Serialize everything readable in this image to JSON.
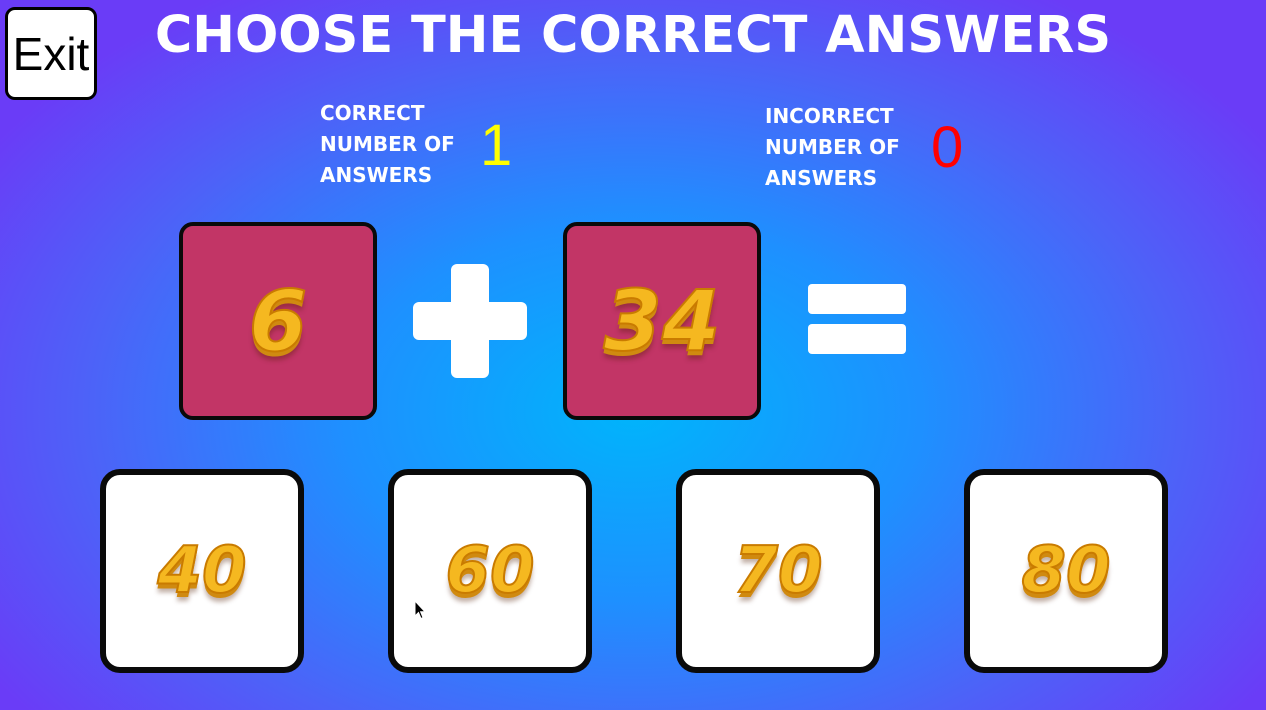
{
  "exit_label": "Exit",
  "title": "CHOOSE THE CORRECT ANSWERS",
  "correct": {
    "label_lines": [
      "CORRECT",
      "NUMBER OF",
      "ANSWERS"
    ],
    "value": "1",
    "color": "#ffff00"
  },
  "incorrect": {
    "label_lines": [
      "INCORRECT",
      "NUMBER OF",
      "ANSWERS"
    ],
    "value": "0",
    "color": "#ff0000"
  },
  "equation": {
    "operand1": "6",
    "operator": "plus-icon",
    "operand2": "34",
    "result": "equals-icon"
  },
  "answers": [
    "40",
    "60",
    "70",
    "80"
  ],
  "colors": {
    "operand_card": "#c23566",
    "number_fill": "#f5b820",
    "background_center": "#00b4fb",
    "background_edge": "#6a3cf7"
  }
}
